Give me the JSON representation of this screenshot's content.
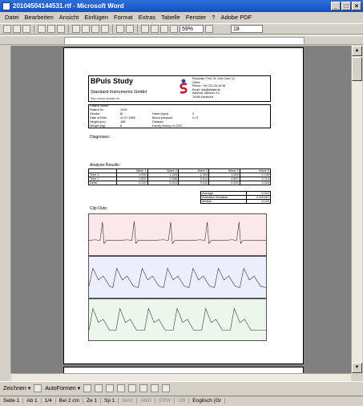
{
  "window": {
    "title": "20104504144531.rtf - Microsoft Word"
  },
  "menu": [
    "Datei",
    "Bearbeiten",
    "Ansicht",
    "Einfügen",
    "Format",
    "Extras",
    "Tabelle",
    "Fenster",
    "?",
    "Adobe PDF"
  ],
  "toolbar": {
    "zoom": "59%",
    "font_size": "18"
  },
  "report": {
    "title": "BPuls Study",
    "company": "Standard Instruments GmbH",
    "url": "http://www.sidata.de",
    "address": [
      "Physician: Prof. Dr. John Doe, 12",
      "Client:",
      "Phone: +49-721-03-16-38",
      "Email: info@sidata.de",
      "Address: Mainzer, 12",
      "76189 Karlsruhe"
    ],
    "patient_name_label": "Patient Name:",
    "patient_id_label": "Patient ID:",
    "patient_id": "1015",
    "fields": [
      [
        "Gender",
        "M"
      ],
      [
        "Date of Birth",
        "11.07.1989"
      ],
      [
        "Height (cm)",
        "188"
      ],
      [
        "Weight (kg)",
        "8"
      ]
    ],
    "fields_right": [
      [
        "Heart (bpm)",
        "0"
      ],
      [
        "Blood pressure",
        "0 / 0"
      ],
      [
        "Diabetic",
        ""
      ],
      [
        "Family history of CVD",
        ""
      ]
    ],
    "diagnoses_label": "Diagnoses:",
    "analysis_label": "Analysis Results:",
    "col_headers": [
      "",
      "Wave 1",
      "Wave 2",
      "Wave 3",
      "Wave 4",
      "Wave 5"
    ],
    "rows": [
      [
        "Time 1",
        "1.000",
        "1.004",
        "1.004",
        "1.005",
        "0.745"
      ],
      [
        "Time 2",
        "1.602",
        "2.946",
        "3.914",
        "4.857",
        "5.714"
      ],
      [
        "Delta",
        "0.220",
        "0.010",
        "0.010",
        "0.000",
        "0.026"
      ]
    ],
    "stats": [
      [
        "Average",
        "0.022"
      ],
      [
        "Standard Deviation",
        "0.000497"
      ],
      [
        "Median",
        "0.025"
      ]
    ],
    "clips_label": "Clip Outs:"
  },
  "drawbar": {
    "draw_label": "Zeichnen ▾",
    "autoshapes": "AutoFormen ▾"
  },
  "status": [
    "Seite 1",
    "Ab 1",
    "1/4",
    "Bei 2 cm",
    "Ze 1",
    "Sp 1",
    "MAK",
    "ÄND",
    "ERW",
    "ÜB",
    "Englisch (Gr"
  ]
}
